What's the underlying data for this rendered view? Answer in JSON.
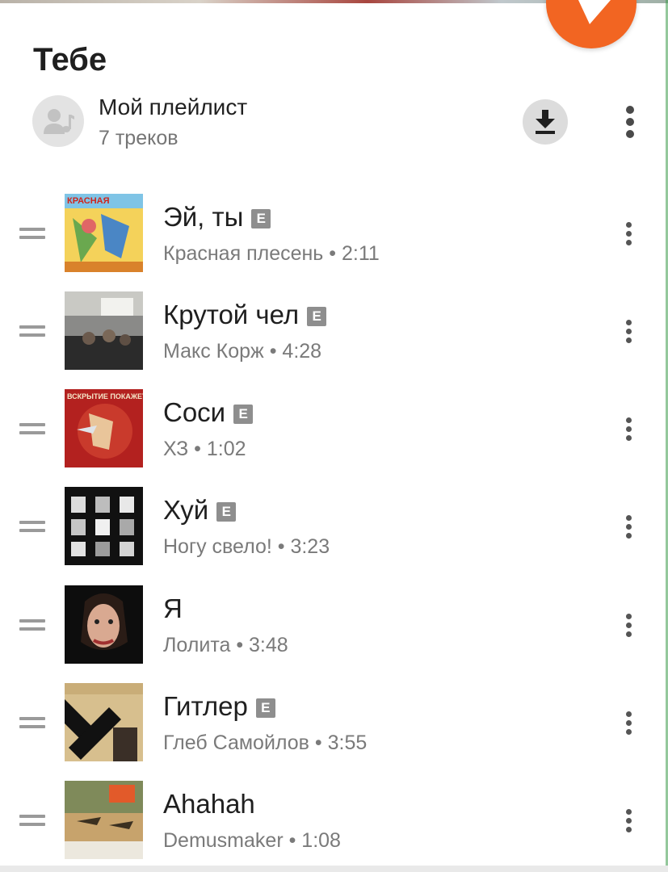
{
  "header": {
    "title": "Тебе"
  },
  "playlist": {
    "name": "Мой плейлист",
    "count": "7 треков"
  },
  "colors": {
    "accent": "#f26522"
  },
  "icons": {
    "play": "play-icon",
    "download": "download-icon",
    "more": "more-vert-icon",
    "drag": "drag-handle-icon",
    "avatar": "playlist-user-icon"
  },
  "tracks": [
    {
      "title": "Эй, ты",
      "explicit": true,
      "subtitle": "Красная плесень • 2:11",
      "badge": "E"
    },
    {
      "title": "Крутой чел",
      "explicit": true,
      "subtitle": "Макс Корж • 4:28",
      "badge": "E"
    },
    {
      "title": "Соси",
      "explicit": true,
      "subtitle": "ХЗ • 1:02",
      "badge": "E"
    },
    {
      "title": "Хуй",
      "explicit": true,
      "subtitle": "Ногу свело! • 3:23",
      "badge": "E"
    },
    {
      "title": "Я",
      "explicit": false,
      "subtitle": "Лолита • 3:48"
    },
    {
      "title": "Гитлер",
      "explicit": true,
      "subtitle": "Глеб Самойлов • 3:55",
      "badge": "E"
    },
    {
      "title": "Ahahah",
      "explicit": false,
      "subtitle": "Demusmaker • 1:08"
    }
  ]
}
